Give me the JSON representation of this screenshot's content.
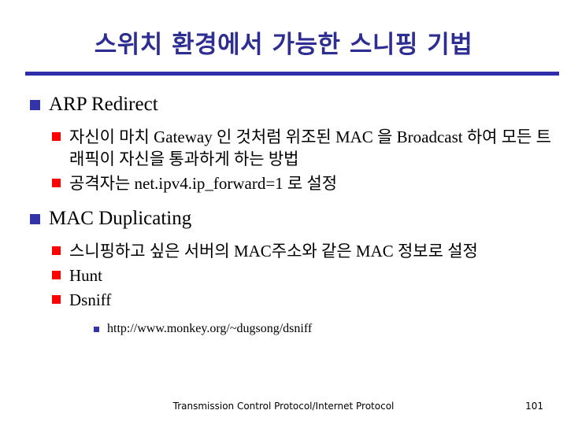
{
  "slide": {
    "title": "스위치 환경에서 가능한 스니핑 기법",
    "accent_color": "#2e2e92",
    "rule_color": "#2e2eaa",
    "bullet_level1_color": "#3333aa",
    "bullet_level2_color": "#ff0000",
    "bullet_level3_color": "#3333aa",
    "background_color": "#ffffff"
  },
  "content": {
    "sections": [
      {
        "heading": "ARP Redirect",
        "items": [
          "자신이 마치 Gateway 인 것처럼 위조된 MAC 을 Broadcast 하여 모든 트래픽이 자신을 통과하게 하는 방법",
          "공격자는 net.ipv4.ip_forward=1 로 설정"
        ]
      },
      {
        "heading": "MAC Duplicating",
        "items": [
          "스니핑하고 싶은 서버의 MAC주소와 같은 MAC 정보로 설정",
          "Hunt",
          "Dsniff"
        ],
        "subitems": [
          "http://www.monkey.org/~dugsong/dsniff"
        ]
      }
    ]
  },
  "footer": {
    "text": "Transmission Control Protocol/Internet Protocol",
    "page_number": "101"
  }
}
